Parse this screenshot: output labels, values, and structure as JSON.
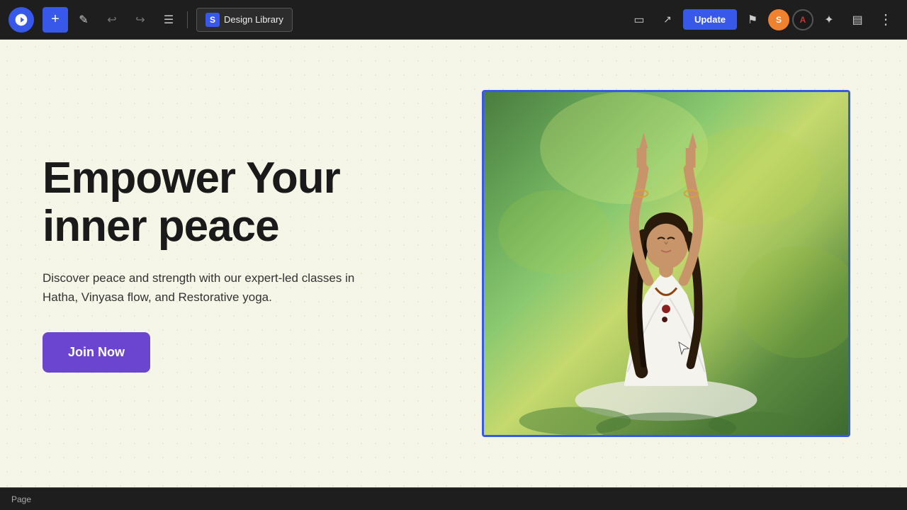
{
  "toolbar": {
    "wp_logo_label": "W",
    "add_button_label": "+",
    "design_library_label": "Design Library",
    "design_library_icon": "S",
    "update_button_label": "Update",
    "tools": [
      {
        "name": "pencil-tool",
        "icon": "✎",
        "label": "Edit"
      },
      {
        "name": "undo-tool",
        "icon": "↩",
        "label": "Undo"
      },
      {
        "name": "redo-tool",
        "icon": "↪",
        "label": "Redo"
      },
      {
        "name": "list-tool",
        "icon": "≡",
        "label": "List view"
      }
    ],
    "right_icons": [
      {
        "name": "preview-desktop-icon",
        "icon": "□",
        "label": "Desktop preview"
      },
      {
        "name": "external-link-icon",
        "icon": "↗",
        "label": "View"
      },
      {
        "name": "flag-icon",
        "icon": "⚑",
        "label": "Flag"
      },
      {
        "name": "stardust-icon",
        "icon": "S",
        "label": "Stardust",
        "bg": "#f0812f"
      },
      {
        "name": "astra-icon",
        "icon": "A",
        "label": "Astra",
        "bg": "#cc3333"
      },
      {
        "name": "sparkle-icon",
        "icon": "✦",
        "label": "AI"
      },
      {
        "name": "sidebar-icon",
        "icon": "⬛",
        "label": "Sidebar"
      },
      {
        "name": "more-icon",
        "icon": "⋮",
        "label": "More"
      }
    ]
  },
  "hero": {
    "title_line1": "Empower Your",
    "title_line2": "inner peace",
    "description": "Discover peace and strength with our expert-led classes in Hatha, Vinyasa flow, and Restorative yoga.",
    "cta_button": "Join Now"
  },
  "status_bar": {
    "label": "Page"
  },
  "colors": {
    "toolbar_bg": "#1e1e1e",
    "content_bg": "#f5f5e8",
    "accent_blue": "#3858e9",
    "cta_purple": "#6b45d0",
    "text_dark": "#1a1a1a",
    "image_border": "#3858e9"
  }
}
